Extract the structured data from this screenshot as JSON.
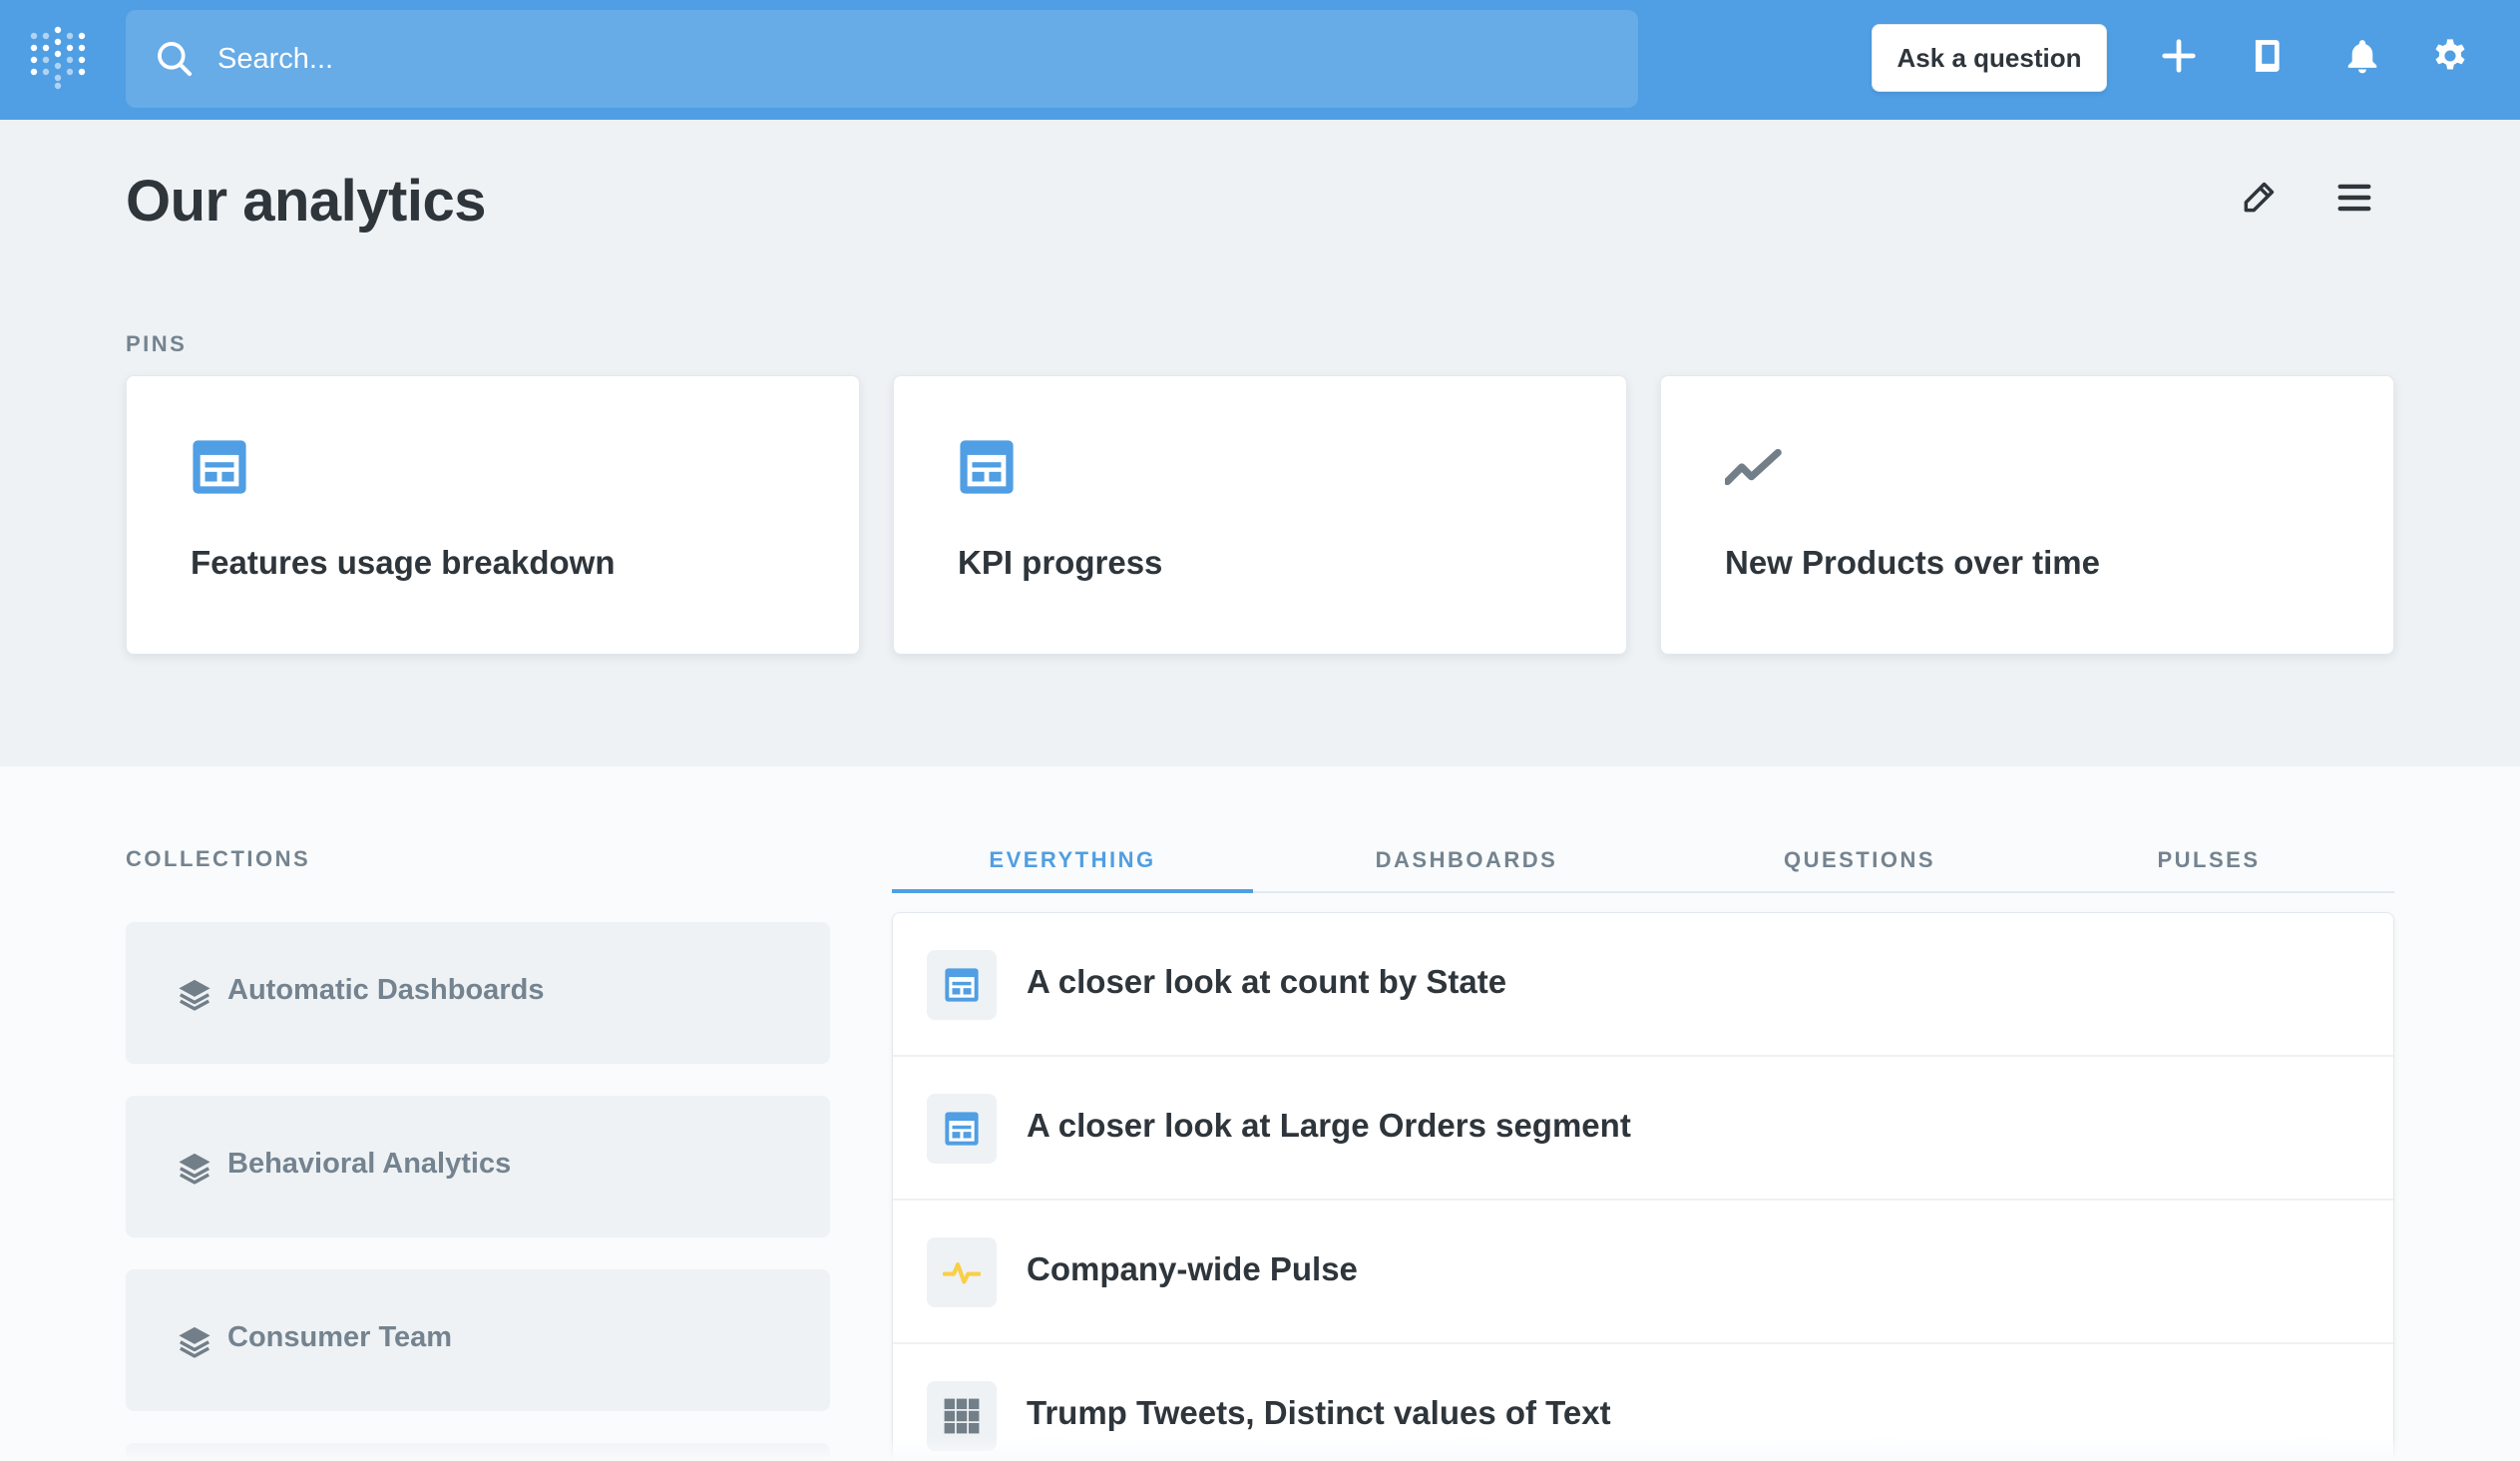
{
  "nav": {
    "search_placeholder": "Search...",
    "ask_question_label": "Ask a question",
    "icons": [
      "metabase-logo-icon",
      "search-icon",
      "add-icon",
      "reference-icon",
      "bell-icon",
      "gear-icon"
    ],
    "accent_color": "#509EE3"
  },
  "header": {
    "title": "Our analytics",
    "icons": [
      "pencil-icon",
      "hamburger-menu-icon"
    ]
  },
  "pins": {
    "label": "PINS",
    "items": [
      {
        "title": "Features usage breakdown",
        "icon": "dashboard-icon"
      },
      {
        "title": "KPI progress",
        "icon": "dashboard-icon"
      },
      {
        "title": "New Products over time",
        "icon": "line-chart-icon"
      }
    ]
  },
  "collections": {
    "label": "COLLECTIONS",
    "items": [
      {
        "label": "Automatic Dashboards",
        "icon": "collection-stack-icon"
      },
      {
        "label": "Behavioral Analytics",
        "icon": "collection-stack-icon"
      },
      {
        "label": "Consumer Team",
        "icon": "collection-stack-icon"
      }
    ]
  },
  "tabs": [
    {
      "label": "EVERYTHING",
      "active": true
    },
    {
      "label": "DASHBOARDS",
      "active": false
    },
    {
      "label": "QUESTIONS",
      "active": false
    },
    {
      "label": "PULSES",
      "active": false
    }
  ],
  "items": [
    {
      "title": "A closer look at count by State",
      "icon": "dashboard-icon"
    },
    {
      "title": "A closer look at Large Orders segment",
      "icon": "dashboard-icon"
    },
    {
      "title": "Company-wide Pulse",
      "icon": "pulse-icon"
    },
    {
      "title": "Trump Tweets, Distinct values of Text",
      "icon": "table-grid-icon"
    }
  ]
}
